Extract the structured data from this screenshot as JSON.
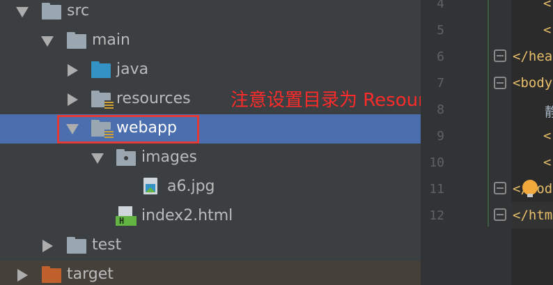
{
  "project_tree": {
    "items": [
      {
        "label": "src",
        "icon": "folder-icon",
        "expanded": true
      },
      {
        "label": "main",
        "icon": "folder-icon",
        "expanded": true
      },
      {
        "label": "java",
        "icon": "source-folder-icon",
        "expanded": false
      },
      {
        "label": "resources",
        "icon": "resources-folder-icon",
        "expanded": false
      },
      {
        "label": "webapp",
        "icon": "resources-folder-icon",
        "expanded": true,
        "selected": true
      },
      {
        "label": "images",
        "icon": "package-folder-icon",
        "expanded": true
      },
      {
        "label": "a6.jpg",
        "icon": "image-file-icon"
      },
      {
        "label": "index2.html",
        "icon": "html-file-icon"
      },
      {
        "label": "test",
        "icon": "folder-icon",
        "expanded": false
      },
      {
        "label": "target",
        "icon": "excluded-folder-icon",
        "expanded": false
      }
    ]
  },
  "annotation": {
    "text": "注意设置目录为 ResourcesRoot",
    "color": "#ff2a2a"
  },
  "editor": {
    "line_numbers": [
      "4",
      "5",
      "6",
      "7",
      "8",
      "9",
      "10",
      "11",
      "12"
    ],
    "code_fragments": {
      "l4": "<",
      "l5": "<",
      "l6": "</hea",
      "l7": "<body",
      "l8": "静",
      "l9": "<",
      "l10": "<",
      "l11": "</bod",
      "l12": "</htm"
    }
  },
  "colors": {
    "selection": "#4b6eaf",
    "tree_background": "#3c3f41",
    "editor_background": "#2b2b2b",
    "highlight_border": "#e53935"
  }
}
